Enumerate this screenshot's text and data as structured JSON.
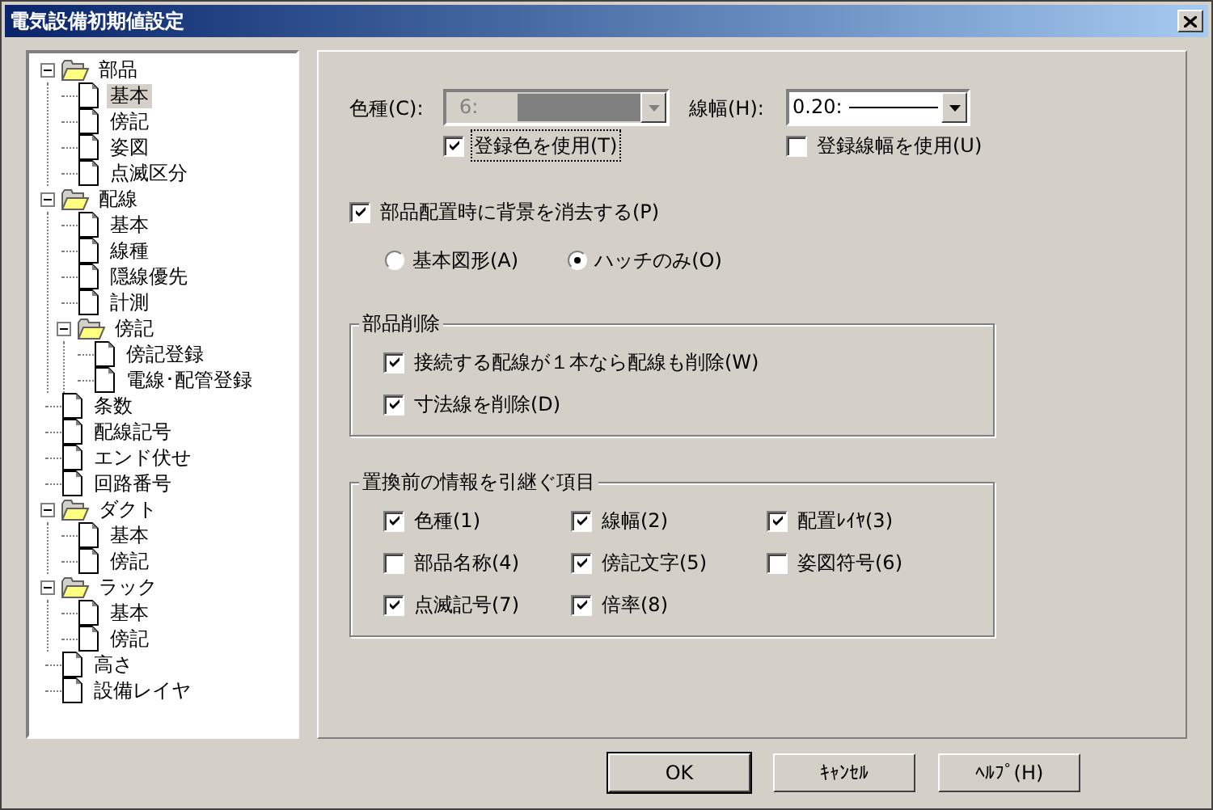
{
  "window": {
    "title": "電気設備初期値設定"
  },
  "tree": [
    {
      "label": "部品",
      "selected": false,
      "expanded": true,
      "children": [
        {
          "label": "基本",
          "selected": true
        },
        {
          "label": "傍記",
          "selected": false
        },
        {
          "label": "姿図",
          "selected": false
        },
        {
          "label": "点滅区分",
          "selected": false
        }
      ]
    },
    {
      "label": "配線",
      "selected": false,
      "expanded": true,
      "children": [
        {
          "label": "基本",
          "selected": false
        },
        {
          "label": "線種",
          "selected": false
        },
        {
          "label": "隠線優先",
          "selected": false
        },
        {
          "label": "計測",
          "selected": false
        },
        {
          "label": "傍記",
          "selected": false,
          "expanded": true,
          "children": [
            {
              "label": "傍記登録",
              "selected": false
            },
            {
              "label": "電線･配管登録",
              "selected": false
            }
          ]
        }
      ]
    },
    {
      "label": "条数",
      "selected": false
    },
    {
      "label": "配線記号",
      "selected": false
    },
    {
      "label": "エンド伏せ",
      "selected": false
    },
    {
      "label": "回路番号",
      "selected": false
    },
    {
      "label": "ダクト",
      "selected": false,
      "expanded": true,
      "children": [
        {
          "label": "基本",
          "selected": false
        },
        {
          "label": "傍記",
          "selected": false
        }
      ]
    },
    {
      "label": "ラック",
      "selected": false,
      "expanded": true,
      "children": [
        {
          "label": "基本",
          "selected": false
        },
        {
          "label": "傍記",
          "selected": false
        }
      ]
    },
    {
      "label": "高さ",
      "selected": false
    },
    {
      "label": "設備レイヤ",
      "selected": false
    }
  ],
  "fields": [
    {
      "label": "色種(C):",
      "value": "6:",
      "disabled": true,
      "kind": "color",
      "option": {
        "label": "登録色を使用(T)",
        "checked": true,
        "focused": true
      }
    },
    {
      "label": "線幅(H):",
      "value": "0.20:",
      "disabled": false,
      "kind": "line",
      "option": {
        "label": "登録線幅を使用(U)",
        "checked": false,
        "focused": false
      }
    }
  ],
  "erase_background": {
    "label": "部品配置時に背景を消去する(P)",
    "checked": true
  },
  "radios": [
    {
      "label": "基本図形(A)",
      "selected": false
    },
    {
      "label": "ハッチのみ(O)",
      "selected": true
    }
  ],
  "groups": [
    {
      "title": "部品削除",
      "kind": "list",
      "items": [
        {
          "label": "接続する配線が１本なら配線も削除(W)",
          "checked": true
        },
        {
          "label": "寸法線を削除(D)",
          "checked": true
        }
      ]
    },
    {
      "title": "置換前の情報を引継ぐ項目",
      "kind": "grid",
      "items": [
        {
          "label": "色種(1)",
          "checked": true
        },
        {
          "label": "線幅(2)",
          "checked": true
        },
        {
          "label": "配置ﾚｲﾔ(3)",
          "checked": true
        },
        {
          "label": "部品名称(4)",
          "checked": false
        },
        {
          "label": "傍記文字(5)",
          "checked": true
        },
        {
          "label": "姿図符号(6)",
          "checked": false
        },
        {
          "label": "点滅記号(7)",
          "checked": true
        },
        {
          "label": "倍率(8)",
          "checked": true
        }
      ]
    }
  ],
  "buttons": [
    {
      "label": "OK",
      "default": true
    },
    {
      "label": "ｷｬﾝｾﾙ",
      "default": false
    },
    {
      "label": "ﾍﾙﾌﾟ(H)",
      "default": false
    }
  ]
}
